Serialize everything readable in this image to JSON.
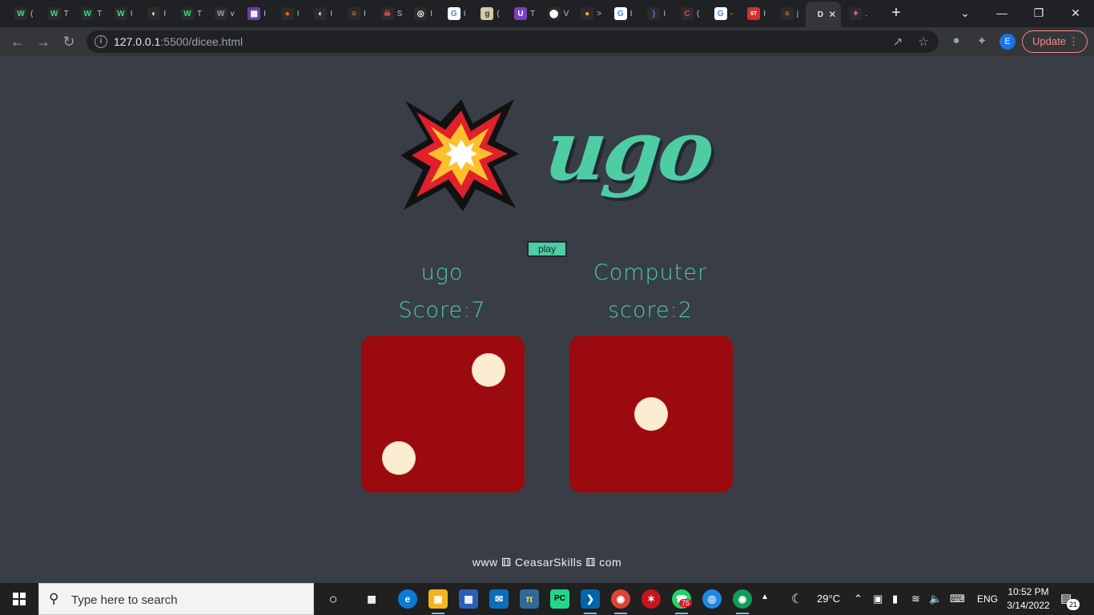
{
  "browser": {
    "tabs": [
      {
        "icon": "W",
        "color": "#2b2b2b",
        "fg": "#3ddc84",
        "title": "("
      },
      {
        "icon": "W",
        "color": "#2b2b2b",
        "fg": "#3ddc84",
        "title": "T"
      },
      {
        "icon": "W",
        "color": "#2b2b2b",
        "fg": "#3ddc84",
        "title": "T"
      },
      {
        "icon": "W",
        "color": "#2b2b2b",
        "fg": "#3ddc84",
        "title": "I"
      },
      {
        "icon": "◐",
        "color": "#2b2b2b",
        "fg": "#ffffff",
        "title": "I"
      },
      {
        "icon": "W",
        "color": "#2b2b2b",
        "fg": "#3ddc84",
        "title": "T"
      },
      {
        "icon": "W",
        "color": "#2b2b2b",
        "fg": "#9aa0a6",
        "title": "v"
      },
      {
        "icon": "▦",
        "color": "#6b3fa0",
        "fg": "#ffffff",
        "title": "I"
      },
      {
        "icon": "●",
        "color": "#2b2b2b",
        "fg": "#ff6a00",
        "title": "I"
      },
      {
        "icon": "◐",
        "color": "#2b2b2b",
        "fg": "#ffffff",
        "title": "I"
      },
      {
        "icon": "≡",
        "color": "#2b2b2b",
        "fg": "#f48024",
        "title": "I"
      },
      {
        "icon": "☠",
        "color": "#2b2b2b",
        "fg": "#e34b4b",
        "title": "S"
      },
      {
        "icon": "◎",
        "color": "#2b2b2b",
        "fg": "#ffffff",
        "title": "I"
      },
      {
        "icon": "G",
        "color": "#ffffff",
        "fg": "#4285f4",
        "title": "I"
      },
      {
        "icon": "g",
        "color": "#d8c8a8",
        "fg": "#333333",
        "title": "("
      },
      {
        "icon": "U",
        "color": "#7b3fbf",
        "fg": "#ffffff",
        "title": "T"
      },
      {
        "icon": "⬤",
        "color": "#2b2b2b",
        "fg": "#ffffff",
        "title": "V"
      },
      {
        "icon": "●",
        "color": "#2b2b2b",
        "fg": "#f5a623",
        "title": ">"
      },
      {
        "icon": "G",
        "color": "#ffffff",
        "fg": "#4285f4",
        "title": "I"
      },
      {
        "icon": "}",
        "color": "#2b2b2b",
        "fg": "#3b82f6",
        "title": "I"
      },
      {
        "icon": "C",
        "color": "#2b2b2b",
        "fg": "#ea4335",
        "title": "("
      },
      {
        "icon": "G",
        "color": "#ffffff",
        "fg": "#4285f4",
        "title": "-"
      },
      {
        "icon": "IIT",
        "color": "#d32f2f",
        "fg": "#ffffff",
        "title": "I"
      },
      {
        "icon": "≡",
        "color": "#2b2b2b",
        "fg": "#f48024",
        "title": "j"
      },
      {
        "icon": "D",
        "color": "#35363a",
        "fg": "#e8eaed",
        "title": "",
        "active": true
      },
      {
        "icon": "✦",
        "color": "#2b2b2b",
        "fg": "#e05d9f",
        "title": "."
      }
    ],
    "new_tab": "+",
    "url_host": "127.0.0.1",
    "url_rest": ":5500/dicee.html",
    "profile_initial": "E",
    "update_label": "Update",
    "update_dots": "⋮",
    "win_min": "—",
    "win_restore": "❐",
    "win_close": "✕",
    "tab_list": "⌄"
  },
  "page": {
    "logo_text": "ugo",
    "play_label": "play",
    "player1": {
      "name": "ugo",
      "score_label": "Score:7",
      "dice_value": 2
    },
    "player2": {
      "name": "Computer",
      "score_label": "score:2",
      "dice_value": 1
    },
    "footer": "www ⚅ CeasarSkills ⚅ com"
  },
  "taskbar": {
    "search_placeholder": "Type here to search",
    "weather": "29°C",
    "language": "ENG",
    "time": "10:52 PM",
    "date": "3/14/2022",
    "notif_count": "21",
    "whatsapp_badge": "75"
  },
  "colors": {
    "accent": "#4ecca3",
    "background": "#393e46",
    "dice": "#9b0a0f",
    "pip": "#fcecd2"
  }
}
